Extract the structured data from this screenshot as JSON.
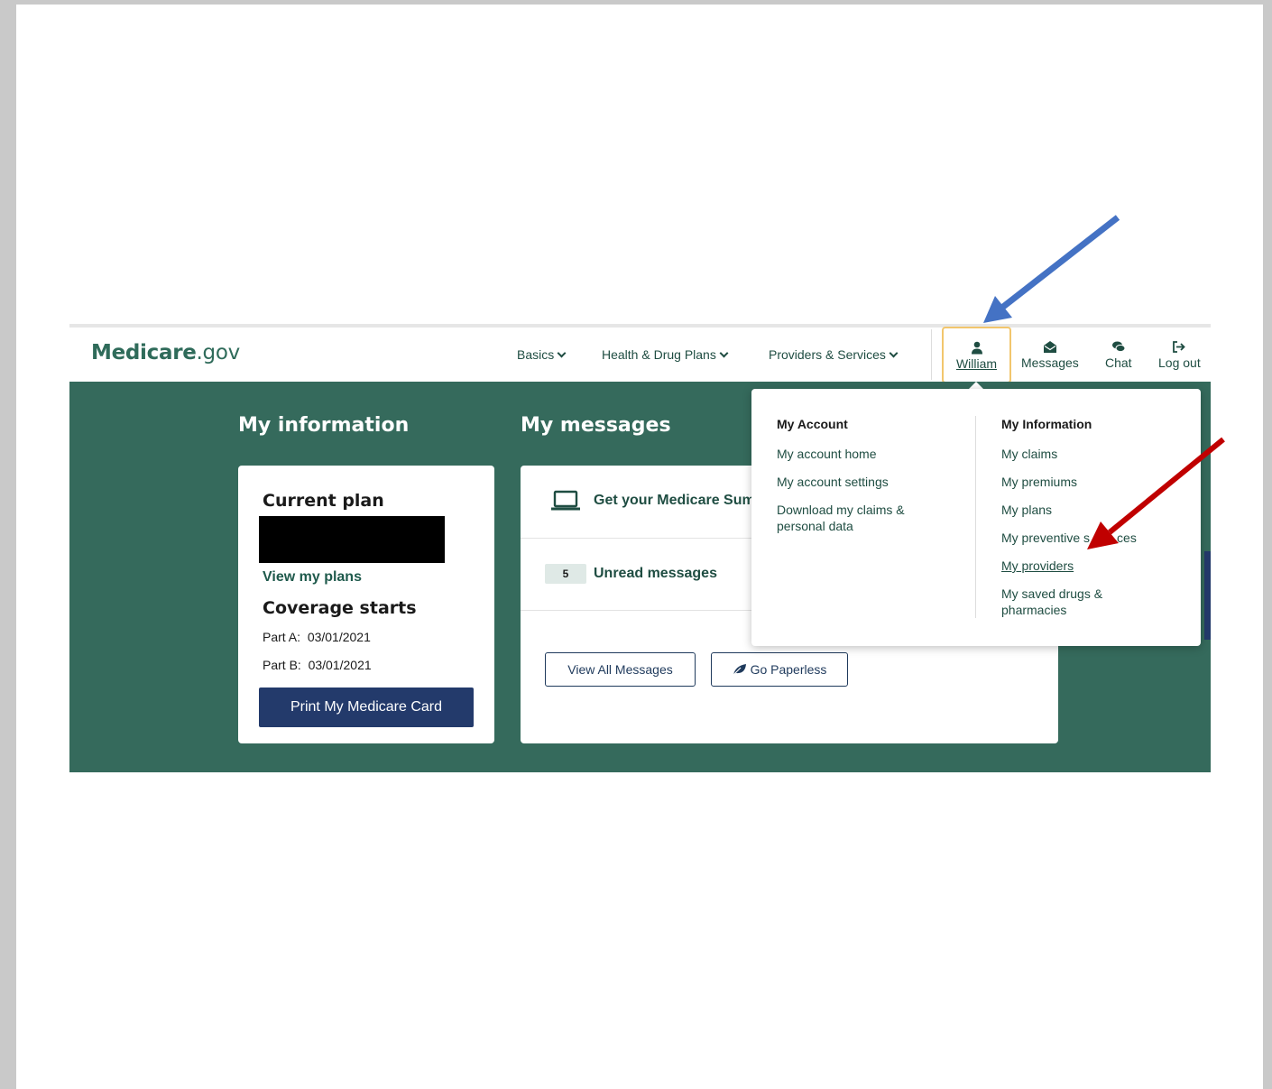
{
  "header": {
    "logo_bold": "Medicare",
    "logo_light": ".gov",
    "nav": [
      {
        "label": "Basics"
      },
      {
        "label": "Health & Drug Plans"
      },
      {
        "label": "Providers & Services"
      }
    ],
    "utility": {
      "user": "William",
      "messages": "Messages",
      "chat": "Chat",
      "logout": "Log out"
    }
  },
  "my_information": {
    "title": "My information",
    "current_plan_label": "Current plan",
    "view_plans_link": "View my plans",
    "coverage_label": "Coverage starts",
    "part_a_label": "Part A:",
    "part_a_date": "03/01/2021",
    "part_b_label": "Part B:",
    "part_b_date": "03/01/2021",
    "print_button": "Print My Medicare Card"
  },
  "my_messages": {
    "title": "My messages",
    "summary_text": "Get your Medicare Sum",
    "unread_count": "5",
    "unread_label": "Unread messages",
    "view_all_button": "View All Messages",
    "paperless_button": "Go Paperless"
  },
  "dropdown": {
    "account_heading": "My Account",
    "account_links": [
      "My account home",
      "My account settings",
      "Download my claims &",
      "personal data"
    ],
    "info_heading": "My Information",
    "info_links": [
      "My claims",
      "My premiums",
      "My plans",
      "My preventive s",
      "ces",
      "My providers",
      "My saved drugs &",
      "pharmacies"
    ]
  },
  "colors": {
    "brand_green": "#356a5c",
    "navy": "#233a6b",
    "highlight": "#f2c66d",
    "blue_arrow": "#4472c4",
    "red_arrow": "#c00000"
  }
}
